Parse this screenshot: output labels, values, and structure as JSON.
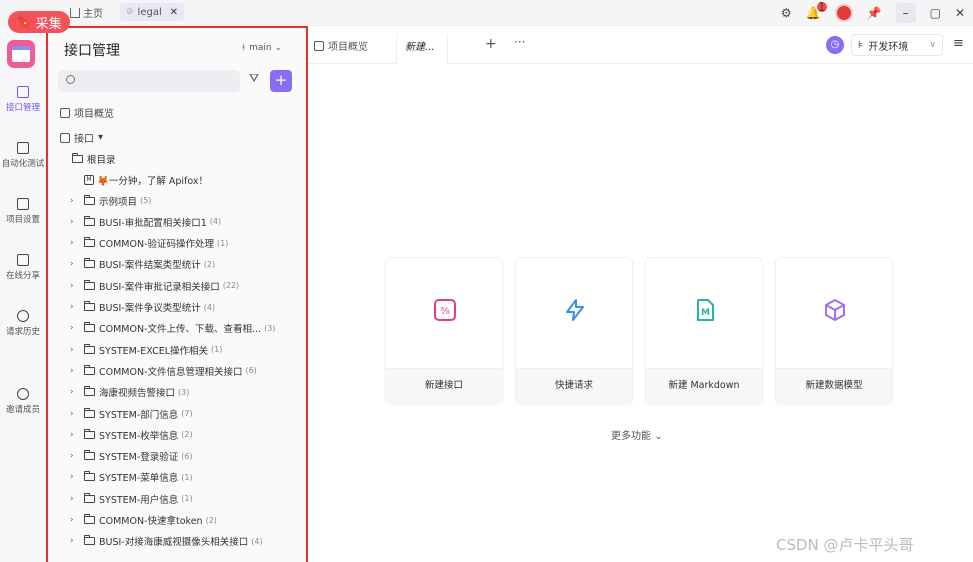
{
  "titlebar": {
    "caiji_label": "采集",
    "home_label": "主页",
    "tab_label": "legal",
    "tab_close": "✕",
    "bell_count": "1"
  },
  "rail": {
    "items": [
      {
        "label": "接口管理"
      },
      {
        "label": "自动化测试"
      },
      {
        "label": "项目设置"
      },
      {
        "label": "在线分享"
      },
      {
        "label": "请求历史"
      },
      {
        "label": "邀请成员"
      }
    ]
  },
  "sidebar": {
    "title": "接口管理",
    "branch": "main",
    "overview_label": "项目概览",
    "api_root_label": "接口",
    "root_dir_label": "根目录",
    "intro_doc_label": "🦊一分钟，了解 Apifox！",
    "folders": [
      {
        "name": "示例项目",
        "count": "(5)"
      },
      {
        "name": "BUSI-审批配置相关接口1",
        "count": "(4)"
      },
      {
        "name": "COMMON-验证码操作处理",
        "count": "(1)"
      },
      {
        "name": "BUSI-案件结案类型统计",
        "count": "(2)"
      },
      {
        "name": "BUSI-案件审批记录相关接口",
        "count": "(22)"
      },
      {
        "name": "BUSI-案件争议类型统计",
        "count": "(4)"
      },
      {
        "name": "COMMON-文件上传、下载、查看相...",
        "count": "(3)"
      },
      {
        "name": "SYSTEM-EXCEL操作相关",
        "count": "(1)"
      },
      {
        "name": "COMMON-文件信息管理相关接口",
        "count": "(6)"
      },
      {
        "name": "海康视频告警接口",
        "count": "(3)"
      },
      {
        "name": "SYSTEM-部门信息",
        "count": "(7)"
      },
      {
        "name": "SYSTEM-枚举信息",
        "count": "(2)"
      },
      {
        "name": "SYSTEM-登录验证",
        "count": "(6)"
      },
      {
        "name": "SYSTEM-菜单信息",
        "count": "(1)"
      },
      {
        "name": "SYSTEM-用户信息",
        "count": "(1)"
      },
      {
        "name": "COMMON-快速拿token",
        "count": "(2)"
      },
      {
        "name": "BUSI-对接海康威视摄像头相关接口",
        "count": "(4)"
      }
    ]
  },
  "main": {
    "tabs": [
      {
        "label": "项目概览"
      },
      {
        "label": "新建..."
      }
    ],
    "env_label": "开发环境",
    "cards": [
      {
        "label": "新建接口",
        "icon": "api-icon",
        "color": "#e0408a"
      },
      {
        "label": "快捷请求",
        "icon": "lightning-icon",
        "color": "#3a8ef0"
      },
      {
        "label": "新建 Markdown",
        "icon": "markdown-icon",
        "color": "#25b5a4"
      },
      {
        "label": "新建数据模型",
        "icon": "cube-icon",
        "color": "#a070f0"
      }
    ],
    "more_label": "更多功能"
  },
  "watermark": "CSDN @卢卡平头哥"
}
